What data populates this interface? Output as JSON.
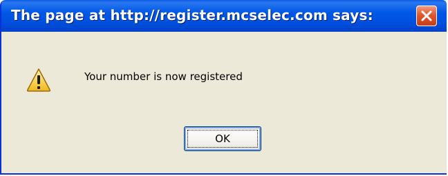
{
  "dialog": {
    "title": "The page at http://register.mcselec.com says:",
    "message": "Your number is now registered",
    "icon": "warning-icon",
    "buttons": {
      "ok_label": "OK"
    }
  },
  "colors": {
    "titlebar": "#0058e6",
    "close_button": "#e0582f",
    "body": "#ece9d8",
    "warning_yellow": "#f7d44a"
  }
}
